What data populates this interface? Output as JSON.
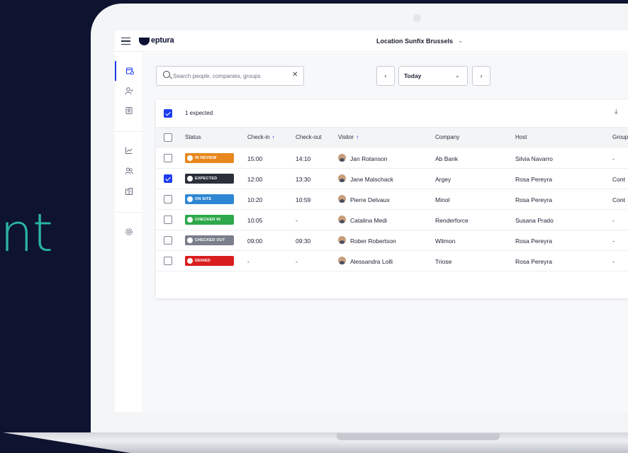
{
  "background_text": "nt",
  "topbar": {
    "brand": "eptura",
    "location": "Location Sunfix Brussels"
  },
  "toolbar": {
    "search_placeholder": "Search people, companies, groups",
    "date": "Today"
  },
  "summary": {
    "expected_label": "1 expected"
  },
  "table": {
    "columns": [
      "Status",
      "Check-in",
      "Check-out",
      "Visitor",
      "Company",
      "Host",
      "Group"
    ],
    "rows": [
      {
        "checked": false,
        "status": "IN REVIEW",
        "status_color": "#e8871e",
        "checkin": "15:00",
        "checkout": "14:10",
        "visitor": "Jan Rotanson",
        "company": "Ab Bank",
        "host": "Silvia Navarro",
        "group": "-"
      },
      {
        "checked": true,
        "status": "EXPECTED",
        "status_color": "#2b2f3a",
        "checkin": "12:00",
        "checkout": "13:30",
        "visitor": "Jane Malschack",
        "company": "Argey",
        "host": "Rosa Pereyra",
        "group": "Cont"
      },
      {
        "checked": false,
        "status": "ON SITE",
        "status_color": "#2e86d3",
        "checkin": "10:20",
        "checkout": "10:59",
        "visitor": "Pierre Delvaux",
        "company": "Minol",
        "host": "Rosa Pereyra",
        "group": "Cont"
      },
      {
        "checked": false,
        "status": "CHECKED IN",
        "status_color": "#2ea84a",
        "checkin": "10:05",
        "checkout": "-",
        "visitor": "Catalina Medi",
        "company": "Renderforce",
        "host": "Susana Prado",
        "group": "-"
      },
      {
        "checked": false,
        "status": "CHECKED OUT",
        "status_color": "#7b7f8c",
        "checkin": "09:00",
        "checkout": "09:30",
        "visitor": "Rober Robertson",
        "company": "Wilmon",
        "host": "Rosa Pereyra",
        "group": "-"
      },
      {
        "checked": false,
        "status": "DENIED",
        "status_color": "#d81e1e",
        "checkin": "-",
        "checkout": "-",
        "visitor": "Alessandra Lolli",
        "company": "Triose",
        "host": "Rosa Pereyra",
        "group": "-"
      }
    ]
  },
  "colors": {
    "accent": "#1f3cf0",
    "navy": "#0e1330",
    "teal": "#2bb3a3"
  },
  "icons": {
    "sidebar": [
      "visits-icon",
      "visitor-check-icon",
      "badge-icon",
      "analytics-icon",
      "people-icon",
      "building-icon",
      "settings-icon"
    ]
  }
}
